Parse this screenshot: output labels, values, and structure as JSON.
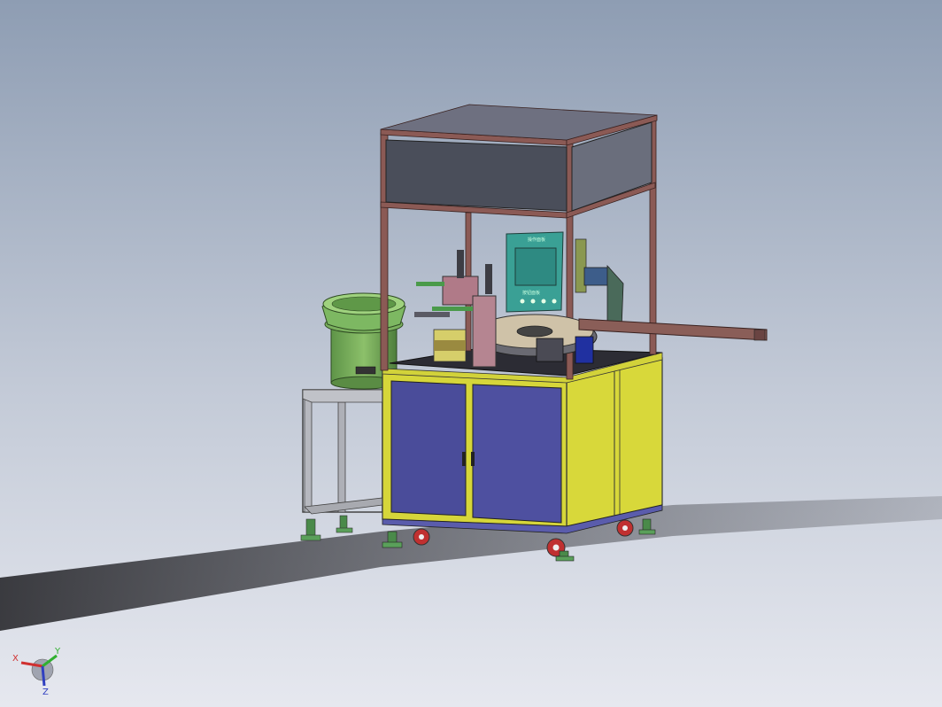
{
  "viewport": {
    "background_top": "#8e9db3",
    "background_bottom": "#e3e6ee"
  },
  "model": {
    "name": "assembly-machine",
    "hmi_header": "操作面板",
    "hmi_button_text": "按钮面板",
    "colors": {
      "frame": "#8b5a55",
      "top_panel": "#4a4e5a",
      "cabinet_yellow": "#d8d83a",
      "cabinet_blue": "#4a4c9a",
      "bowl_green": "#6aa050",
      "hmi_teal": "#3aa095",
      "stand_grey": "#b0b2b8",
      "wheel_red": "#c03030"
    }
  },
  "triad": {
    "x_label": "X",
    "y_label": "Y",
    "z_label": "Z",
    "x_color": "#d03030",
    "y_color": "#30b030",
    "z_color": "#3040c0"
  }
}
